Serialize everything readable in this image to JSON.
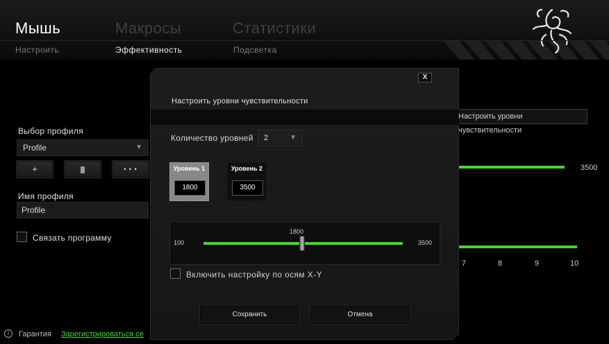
{
  "nav": {
    "main_tabs": [
      "Мышь",
      "Макросы",
      "Статистики"
    ],
    "sub_tabs": [
      "Настроить",
      "Эффективность",
      "Подсветка"
    ]
  },
  "left_panel": {
    "profile_select_label": "Выбор профиля",
    "profile_selected": "Profile",
    "add_button": "+",
    "more_button": "• • •",
    "profile_name_label": "Имя профиля",
    "profile_name_value": "Profile",
    "link_program_label": "Связать программу"
  },
  "footer": {
    "warranty": "Гарантия",
    "register_link": "Зарегистрироваться се"
  },
  "background": {
    "tooltip": "Настроить уровни чувствительности",
    "value_top": "3500",
    "axis_ticks": [
      "7",
      "8",
      "9",
      "10"
    ]
  },
  "modal": {
    "close": "X",
    "title": "Настроить уровни чувствительности",
    "levels_count_label": "Количество уровней",
    "levels_count_value": "2",
    "levels": [
      {
        "title": "Уровень 1",
        "value": "1800",
        "active": true
      },
      {
        "title": "Уровень 2",
        "value": "3500",
        "active": false
      }
    ],
    "slider": {
      "min": "100",
      "max": "3500",
      "value": "1800"
    },
    "xy_label": "Включить настройку по осям X-Y",
    "save_button": "Сохранить",
    "cancel_button": "Отмена"
  },
  "colors": {
    "accent": "#44d62c",
    "background": "#000000"
  }
}
